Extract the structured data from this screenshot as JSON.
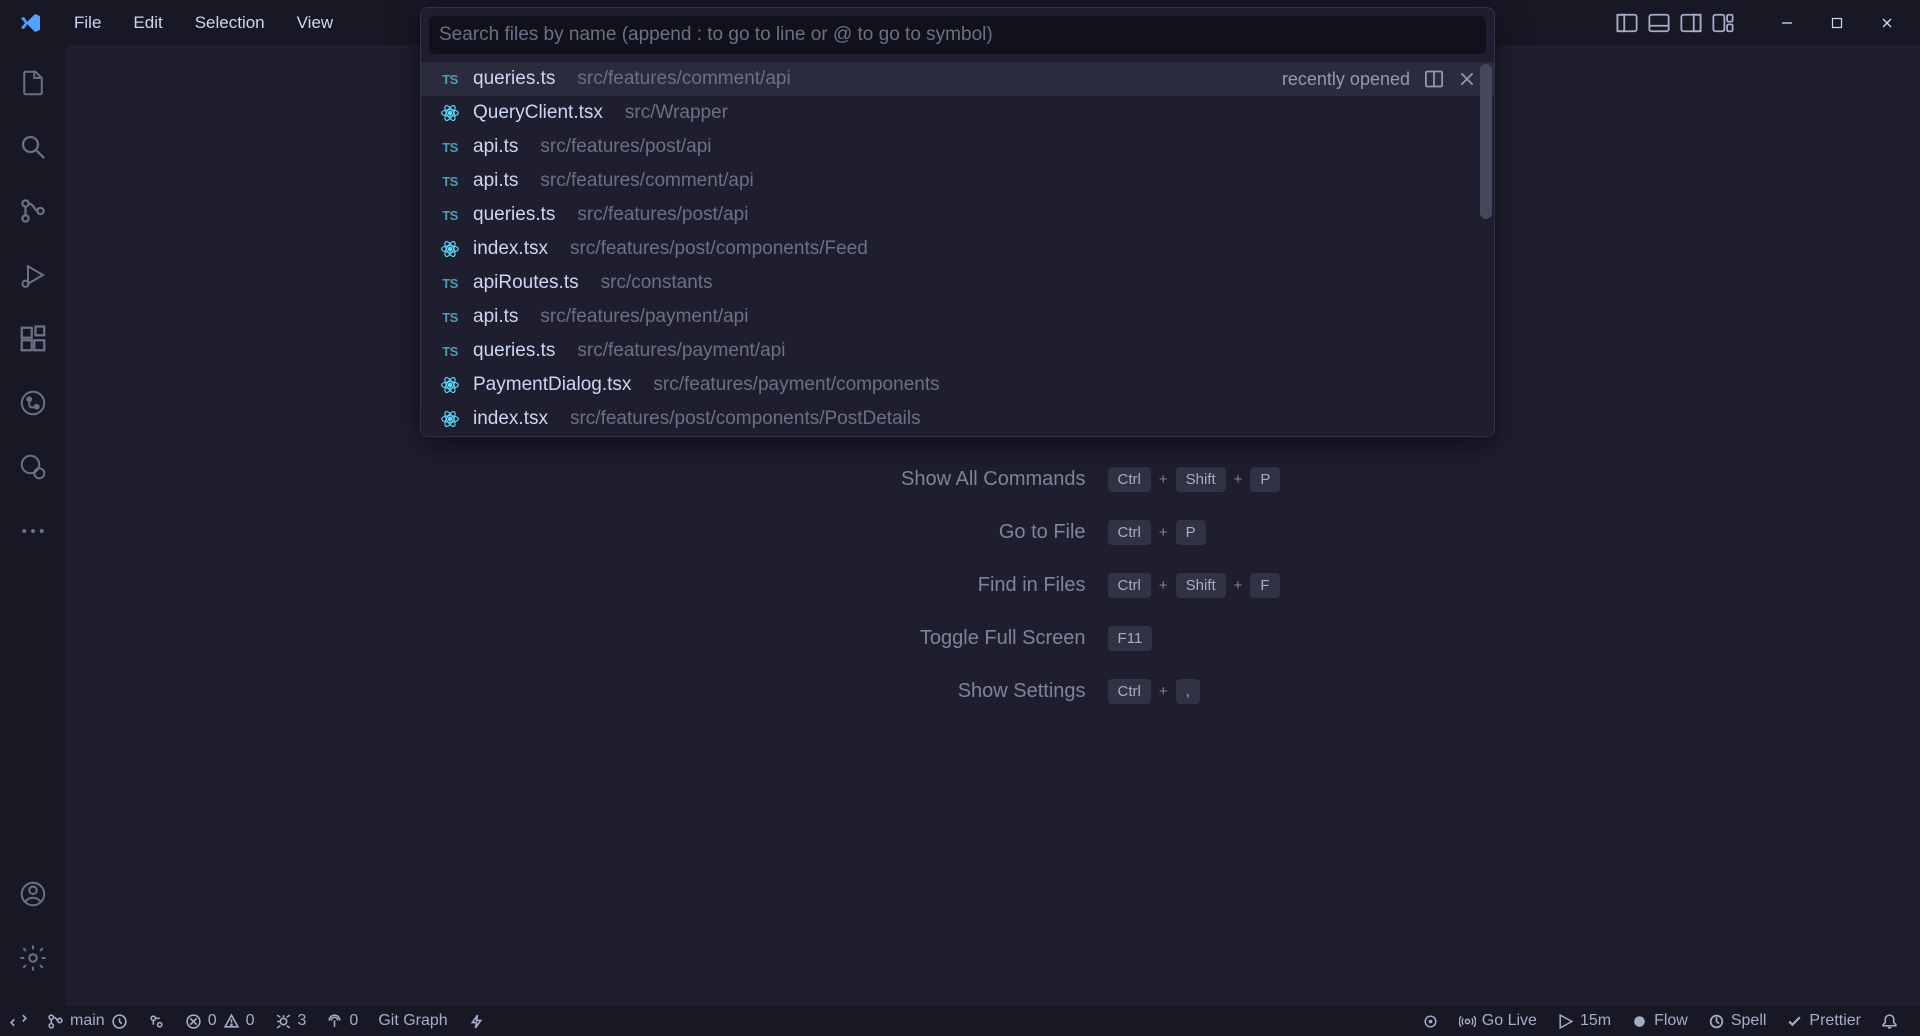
{
  "menu": {
    "file": "File",
    "edit": "Edit",
    "selection": "Selection",
    "view": "View"
  },
  "quickOpen": {
    "placeholder": "Search files by name (append : to go to line or @ to go to symbol)",
    "recentLabel": "recently opened",
    "items": [
      {
        "icon": "ts",
        "name": "queries.ts",
        "path": "src/features/comment/api",
        "selected": true,
        "recent": true
      },
      {
        "icon": "react",
        "name": "QueryClient.tsx",
        "path": "src/Wrapper"
      },
      {
        "icon": "ts",
        "name": "api.ts",
        "path": "src/features/post/api"
      },
      {
        "icon": "ts",
        "name": "api.ts",
        "path": "src/features/comment/api"
      },
      {
        "icon": "ts",
        "name": "queries.ts",
        "path": "src/features/post/api"
      },
      {
        "icon": "react",
        "name": "index.tsx",
        "path": "src/features/post/components/Feed"
      },
      {
        "icon": "ts",
        "name": "apiRoutes.ts",
        "path": "src/constants"
      },
      {
        "icon": "ts",
        "name": "api.ts",
        "path": "src/features/payment/api"
      },
      {
        "icon": "ts",
        "name": "queries.ts",
        "path": "src/features/payment/api"
      },
      {
        "icon": "react",
        "name": "PaymentDialog.tsx",
        "path": "src/features/payment/components"
      },
      {
        "icon": "react",
        "name": "index.tsx",
        "path": "src/features/post/components/PostDetails"
      }
    ]
  },
  "welcome": {
    "rows": [
      {
        "label": "Show All Commands",
        "keys": [
          "Ctrl",
          "Shift",
          "P"
        ]
      },
      {
        "label": "Go to File",
        "keys": [
          "Ctrl",
          "P"
        ]
      },
      {
        "label": "Find in Files",
        "keys": [
          "Ctrl",
          "Shift",
          "F"
        ]
      },
      {
        "label": "Toggle Full Screen",
        "keys": [
          "F11"
        ]
      },
      {
        "label": "Show Settings",
        "keys": [
          "Ctrl",
          ","
        ]
      }
    ]
  },
  "status": {
    "branch": "main",
    "errors": "0",
    "warnings": "0",
    "problems": "3",
    "ports": "0",
    "gitgraph": "Git Graph",
    "golive": "Go Live",
    "wakatime": "15m",
    "flow": "Flow",
    "spell": "Spell",
    "prettier": "Prettier"
  }
}
